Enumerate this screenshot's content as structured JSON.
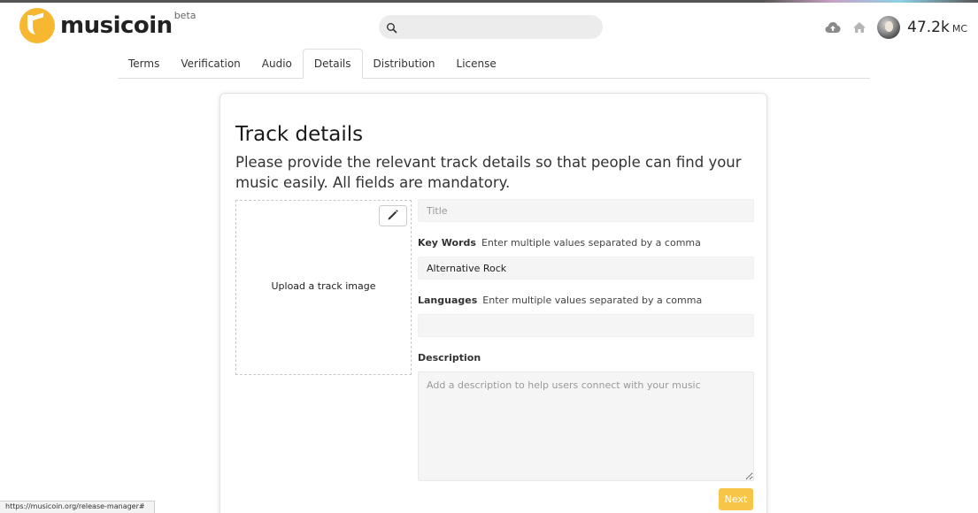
{
  "header": {
    "brand_name": "musicoin",
    "brand_badge": "beta",
    "search_placeholder": "",
    "balance_value": "47.2k",
    "balance_unit": "MC",
    "icons": [
      "upload-cloud-icon",
      "home-icon",
      "avatar"
    ]
  },
  "tabs": [
    {
      "label": "Terms",
      "active": false
    },
    {
      "label": "Verification",
      "active": false
    },
    {
      "label": "Audio",
      "active": false
    },
    {
      "label": "Details",
      "active": true
    },
    {
      "label": "Distribution",
      "active": false
    },
    {
      "label": "License",
      "active": false
    }
  ],
  "card": {
    "title": "Track details",
    "subtitle": "Please provide the relevant track details so that people can find your music easily. All fields are mandatory.",
    "upload_label": "Upload a track image",
    "title_field": {
      "placeholder": "Title",
      "value": ""
    },
    "keywords": {
      "label": "Key Words",
      "hint": "Enter multiple values separated by a comma",
      "value": "Alternative Rock"
    },
    "languages": {
      "label": "Languages",
      "hint": "Enter multiple values separated by a comma",
      "value": ""
    },
    "description": {
      "label": "Description",
      "placeholder": "Add a description to help users connect with your music",
      "value": ""
    },
    "next_label": "Next"
  },
  "status_bar": {
    "url": "https://musicoin.org/release-manager#"
  },
  "colors": {
    "brand": "#f7b731",
    "next_button": "#f7c548",
    "input_bg": "#f5f5f5"
  }
}
